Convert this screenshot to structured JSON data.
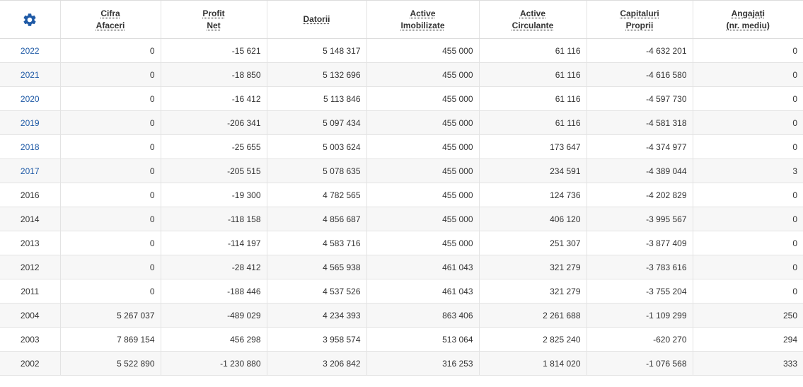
{
  "settings_icon": "gear-icon",
  "accent_color": "#1f5aa6",
  "columns": [
    {
      "line1": "Cifra",
      "line2": "Afaceri"
    },
    {
      "line1": "Profit",
      "line2": "Net"
    },
    {
      "line1": "Datorii",
      "line2": ""
    },
    {
      "line1": "Active",
      "line2": "Imobilizate"
    },
    {
      "line1": "Active",
      "line2": "Circulante"
    },
    {
      "line1": "Capitaluri",
      "line2": "Proprii"
    },
    {
      "line1": "Angajați",
      "line2": "(nr. mediu)"
    }
  ],
  "rows": [
    {
      "year": "2022",
      "link": true,
      "cifra_afaceri": "0",
      "profit_net": "-15 621",
      "datorii": "5 148 317",
      "active_imobilizate": "455 000",
      "active_circulante": "61 116",
      "capitaluri_proprii": "-4 632 201",
      "angajati": "0"
    },
    {
      "year": "2021",
      "link": true,
      "cifra_afaceri": "0",
      "profit_net": "-18 850",
      "datorii": "5 132 696",
      "active_imobilizate": "455 000",
      "active_circulante": "61 116",
      "capitaluri_proprii": "-4 616 580",
      "angajati": "0"
    },
    {
      "year": "2020",
      "link": true,
      "cifra_afaceri": "0",
      "profit_net": "-16 412",
      "datorii": "5 113 846",
      "active_imobilizate": "455 000",
      "active_circulante": "61 116",
      "capitaluri_proprii": "-4 597 730",
      "angajati": "0"
    },
    {
      "year": "2019",
      "link": true,
      "cifra_afaceri": "0",
      "profit_net": "-206 341",
      "datorii": "5 097 434",
      "active_imobilizate": "455 000",
      "active_circulante": "61 116",
      "capitaluri_proprii": "-4 581 318",
      "angajati": "0"
    },
    {
      "year": "2018",
      "link": true,
      "cifra_afaceri": "0",
      "profit_net": "-25 655",
      "datorii": "5 003 624",
      "active_imobilizate": "455 000",
      "active_circulante": "173 647",
      "capitaluri_proprii": "-4 374 977",
      "angajati": "0"
    },
    {
      "year": "2017",
      "link": true,
      "cifra_afaceri": "0",
      "profit_net": "-205 515",
      "datorii": "5 078 635",
      "active_imobilizate": "455 000",
      "active_circulante": "234 591",
      "capitaluri_proprii": "-4 389 044",
      "angajati": "3"
    },
    {
      "year": "2016",
      "link": false,
      "cifra_afaceri": "0",
      "profit_net": "-19 300",
      "datorii": "4 782 565",
      "active_imobilizate": "455 000",
      "active_circulante": "124 736",
      "capitaluri_proprii": "-4 202 829",
      "angajati": "0"
    },
    {
      "year": "2014",
      "link": false,
      "cifra_afaceri": "0",
      "profit_net": "-118 158",
      "datorii": "4 856 687",
      "active_imobilizate": "455 000",
      "active_circulante": "406 120",
      "capitaluri_proprii": "-3 995 567",
      "angajati": "0"
    },
    {
      "year": "2013",
      "link": false,
      "cifra_afaceri": "0",
      "profit_net": "-114 197",
      "datorii": "4 583 716",
      "active_imobilizate": "455 000",
      "active_circulante": "251 307",
      "capitaluri_proprii": "-3 877 409",
      "angajati": "0"
    },
    {
      "year": "2012",
      "link": false,
      "cifra_afaceri": "0",
      "profit_net": "-28 412",
      "datorii": "4 565 938",
      "active_imobilizate": "461 043",
      "active_circulante": "321 279",
      "capitaluri_proprii": "-3 783 616",
      "angajati": "0"
    },
    {
      "year": "2011",
      "link": false,
      "cifra_afaceri": "0",
      "profit_net": "-188 446",
      "datorii": "4 537 526",
      "active_imobilizate": "461 043",
      "active_circulante": "321 279",
      "capitaluri_proprii": "-3 755 204",
      "angajati": "0"
    },
    {
      "year": "2004",
      "link": false,
      "cifra_afaceri": "5 267 037",
      "profit_net": "-489 029",
      "datorii": "4 234 393",
      "active_imobilizate": "863 406",
      "active_circulante": "2 261 688",
      "capitaluri_proprii": "-1 109 299",
      "angajati": "250"
    },
    {
      "year": "2003",
      "link": false,
      "cifra_afaceri": "7 869 154",
      "profit_net": "456 298",
      "datorii": "3 958 574",
      "active_imobilizate": "513 064",
      "active_circulante": "2 825 240",
      "capitaluri_proprii": "-620 270",
      "angajati": "294"
    },
    {
      "year": "2002",
      "link": false,
      "cifra_afaceri": "5 522 890",
      "profit_net": "-1 230 880",
      "datorii": "3 206 842",
      "active_imobilizate": "316 253",
      "active_circulante": "1 814 020",
      "capitaluri_proprii": "-1 076 568",
      "angajati": "333"
    }
  ]
}
